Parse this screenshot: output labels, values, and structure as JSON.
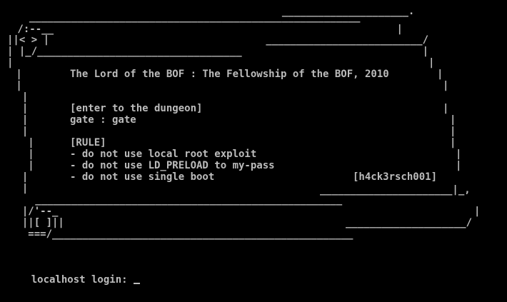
{
  "screen": {
    "background": "#000000",
    "text_color": "#bcbcbc"
  },
  "banner": {
    "art": [
      "                                            _____________________.",
      "  _______________________________________________________",
      " /:--__                                                         |",
      "||< > |                                    __________________________/",
      "| |_/__________________________________                              |",
      "|                                                                     |",
      " |",
      " |",
      "  |",
      "  |",
      "  |",
      "  |",
      "   |",
      "   |",
      "   |",
      "  |",
      "  |",
      "   ___________________________________________________",
      "  |/'--_",
      "  ||[ ]||",
      "   ===/__________________________________________________"
    ],
    "title": "The Lord of the BOF : The Fellowship of the BOF, 2010",
    "lines": [
      "[enter to the dungeon]",
      "gate : gate",
      "",
      "[RULE]",
      "- do not use local root exploit",
      "- do not use LD_PRELOAD to my-pass",
      "- do not use single boot"
    ],
    "signature": "[h4ck3rsch001]"
  },
  "prompt": {
    "label": "localhost login: ",
    "value": ""
  }
}
